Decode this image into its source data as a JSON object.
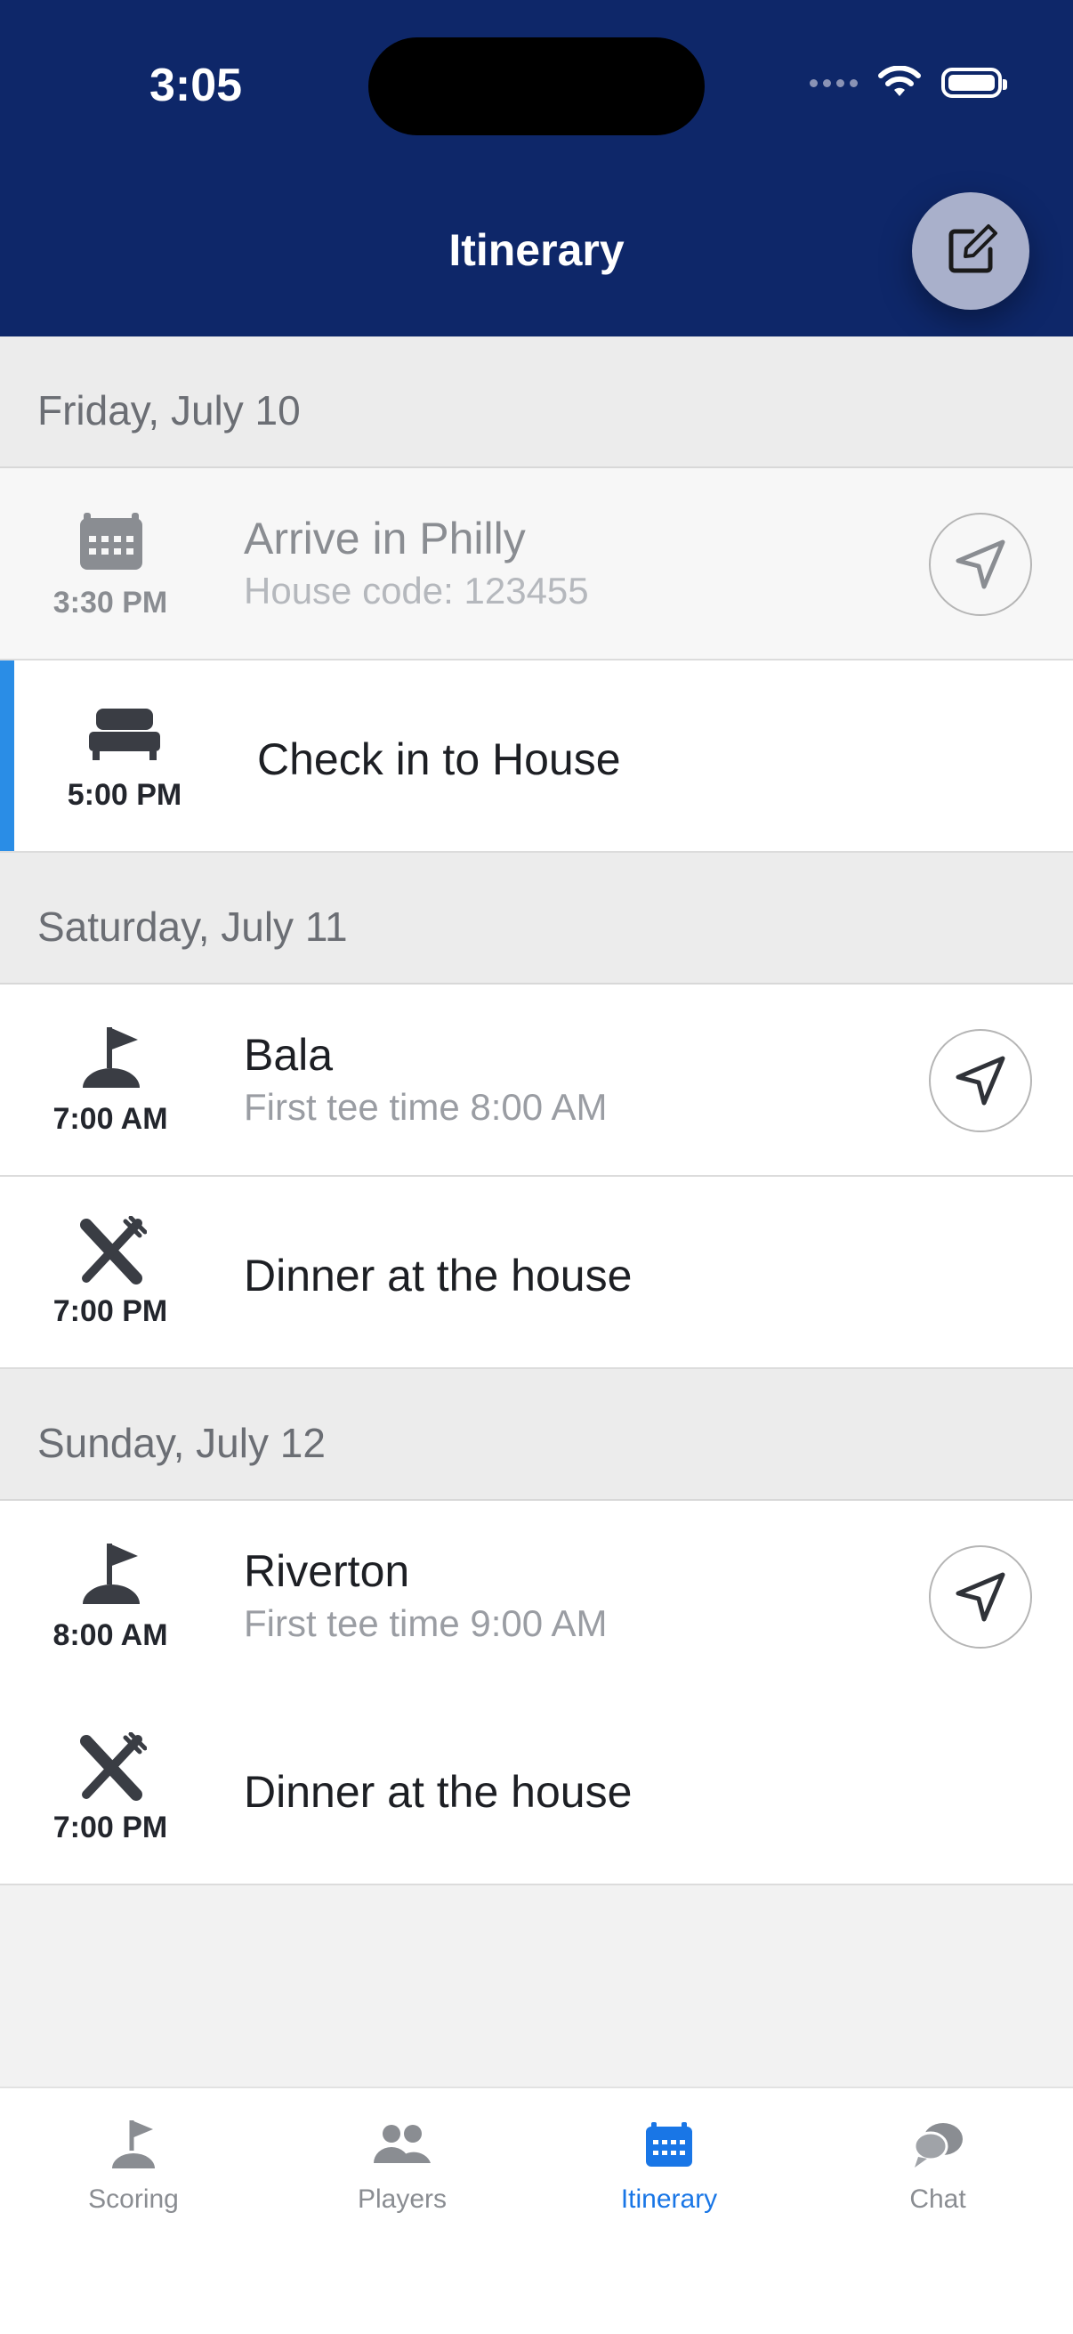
{
  "status_bar": {
    "time": "3:05"
  },
  "header": {
    "title": "Itinerary"
  },
  "sections": [
    {
      "date": "Friday, July 10",
      "items": [
        {
          "time": "3:30 PM",
          "title": "Arrive in Philly",
          "subtitle": "House code: 123455",
          "icon": "calendar-icon"
        },
        {
          "time": "5:00 PM",
          "title": "Check in to House",
          "icon": "bed-icon"
        }
      ]
    },
    {
      "date": "Saturday, July 11",
      "items": [
        {
          "time": "7:00 AM",
          "title": "Bala",
          "subtitle": "First tee time 8:00 AM",
          "icon": "golf-flag-icon"
        },
        {
          "time": "7:00 PM",
          "title": "Dinner at the house",
          "icon": "utensils-icon"
        }
      ]
    },
    {
      "date": "Sunday, July 12",
      "items": [
        {
          "time": "8:00 AM",
          "title": "Riverton",
          "subtitle": "First tee time 9:00 AM",
          "icon": "golf-flag-icon"
        },
        {
          "time": "7:00 PM",
          "title": "Dinner at the house",
          "icon": "utensils-icon"
        }
      ]
    }
  ],
  "tabs": [
    {
      "label": "Scoring",
      "icon": "golf-flag-icon"
    },
    {
      "label": "Players",
      "icon": "people-icon"
    },
    {
      "label": "Itinerary",
      "icon": "calendar-icon",
      "active": true
    },
    {
      "label": "Chat",
      "icon": "chat-icon"
    }
  ],
  "colors": {
    "header": "#0e2769",
    "accent": "#1976e6",
    "current_bar": "#2a8de6"
  }
}
